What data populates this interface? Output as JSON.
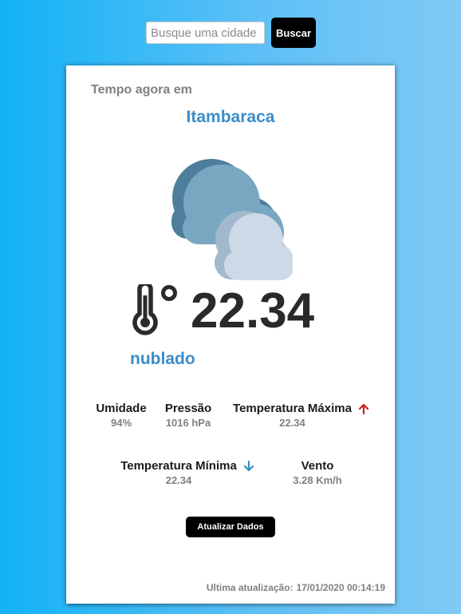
{
  "search": {
    "placeholder": "Busque uma cidade",
    "value": "",
    "button_label": "Buscar"
  },
  "weather": {
    "now_label": "Tempo agora em",
    "city": "Itambaraca",
    "icon": "cloudy-icon",
    "temperature_icon": "thermometer-degree-icon",
    "temperature": "22.34",
    "description": "nublado"
  },
  "stats": {
    "humidity": {
      "label": "Umidade",
      "value": "94%"
    },
    "pressure": {
      "label": "Pressão",
      "value": "1016 hPa"
    },
    "temp_max": {
      "label": "Temperatura Máxima",
      "value": "22.34",
      "icon": "arrow-up-icon",
      "color": "#d0201c"
    },
    "temp_min": {
      "label": "Temperatura Mínima",
      "value": "22.34",
      "icon": "arrow-down-icon",
      "color": "#3b8dc8"
    },
    "wind": {
      "label": "Vento",
      "value": "3.28 Km/h"
    }
  },
  "refresh_label": "Atualizar Dados",
  "last_update": {
    "label": "Ultima atualização:",
    "value": "17/01/2020 00:14:19"
  },
  "colors": {
    "accent": "#3b8dc8",
    "background_start": "#12b2f6",
    "background_end": "#80c9f5"
  }
}
